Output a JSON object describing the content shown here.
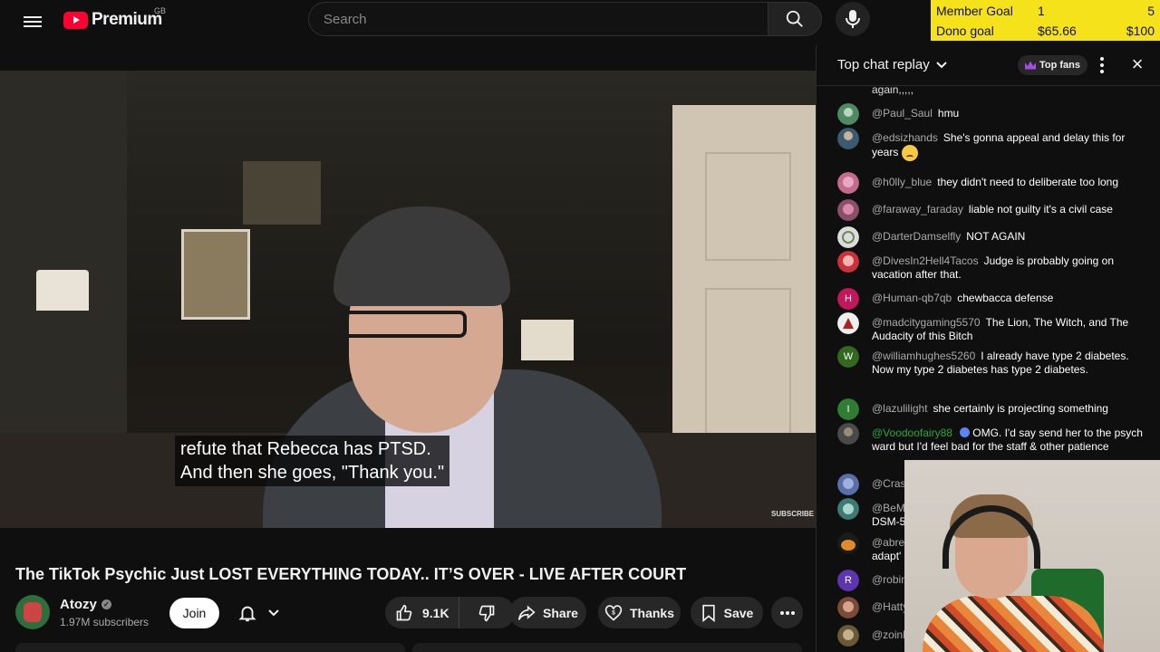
{
  "header": {
    "brand": "Premium",
    "region": "GB",
    "search_placeholder": "Search"
  },
  "goals": {
    "member_label": "Member Goal",
    "member_current": "1",
    "member_target": "5",
    "dono_label": "Dono goal",
    "dono_current": "$65.66",
    "dono_target": "$100"
  },
  "video": {
    "subtitle_line1": "refute that Rebecca has PTSD.",
    "subtitle_line2": "And then she goes, \"Thank you.\"",
    "watermark": "SUBSCRIBE",
    "title": "The TikTok Psychic Just LOST EVERYTHING TODAY.. IT’S OVER - LIVE AFTER COURT"
  },
  "channel": {
    "name": "Atozy",
    "subscribers": "1.97M subscribers",
    "join_label": "Join"
  },
  "actions": {
    "likes": "9.1K",
    "share": "Share",
    "thanks": "Thanks",
    "save": "Save"
  },
  "chat": {
    "title": "Top chat replay",
    "top_fans": "Top fans",
    "cut_top_text": "again,,,,,",
    "messages": [
      {
        "author": "@Paul_Saul",
        "text": "hmu"
      },
      {
        "author": "@edsizhands",
        "text": "She's gonna appeal and delay this for years"
      },
      {
        "author": "@h0lly_blue",
        "text": "they didn't need to deliberate too long"
      },
      {
        "author": "@faraway_faraday",
        "text": "liable not guilty it's a civil case"
      },
      {
        "author": "@DarterDamselfly",
        "text": "NOT AGAIN"
      },
      {
        "author": "@DivesIn2Hell4Tacos",
        "text": "Judge is probably going on vacation after that."
      },
      {
        "author": "@Human-qb7qb",
        "text": "chewbacca defense",
        "initial": "H"
      },
      {
        "author": "@madcitygaming5570",
        "text": "The Lion, The Witch, and The Audacity of this Bitch"
      },
      {
        "author": "@williamhughes5260",
        "text": "I already have type 2 diabetes. Now my type 2 diabetes has type 2 diabetes.",
        "initial": "W"
      },
      {
        "author": "@lazulilight",
        "text": "she certainly is projecting something",
        "initial": "I"
      },
      {
        "author": "@Voodoofairy88",
        "text": "OMG. I'd say send her to the psych ward but I'd feel bad for the staff & other patience"
      },
      {
        "author": "@Cras",
        "text": ""
      },
      {
        "author": "@BeM",
        "text": "DSM-5"
      },
      {
        "author": "@abre",
        "text": "adapt'"
      },
      {
        "author": "@robin",
        "text": "",
        "initial": "R"
      },
      {
        "author": "@Hatty",
        "text": ""
      },
      {
        "author": "@zoink",
        "text": ""
      }
    ]
  },
  "colors": {
    "brand_red": "#ff0033",
    "goal_yellow": "#f5e21b",
    "member_green": "#2ba640"
  }
}
